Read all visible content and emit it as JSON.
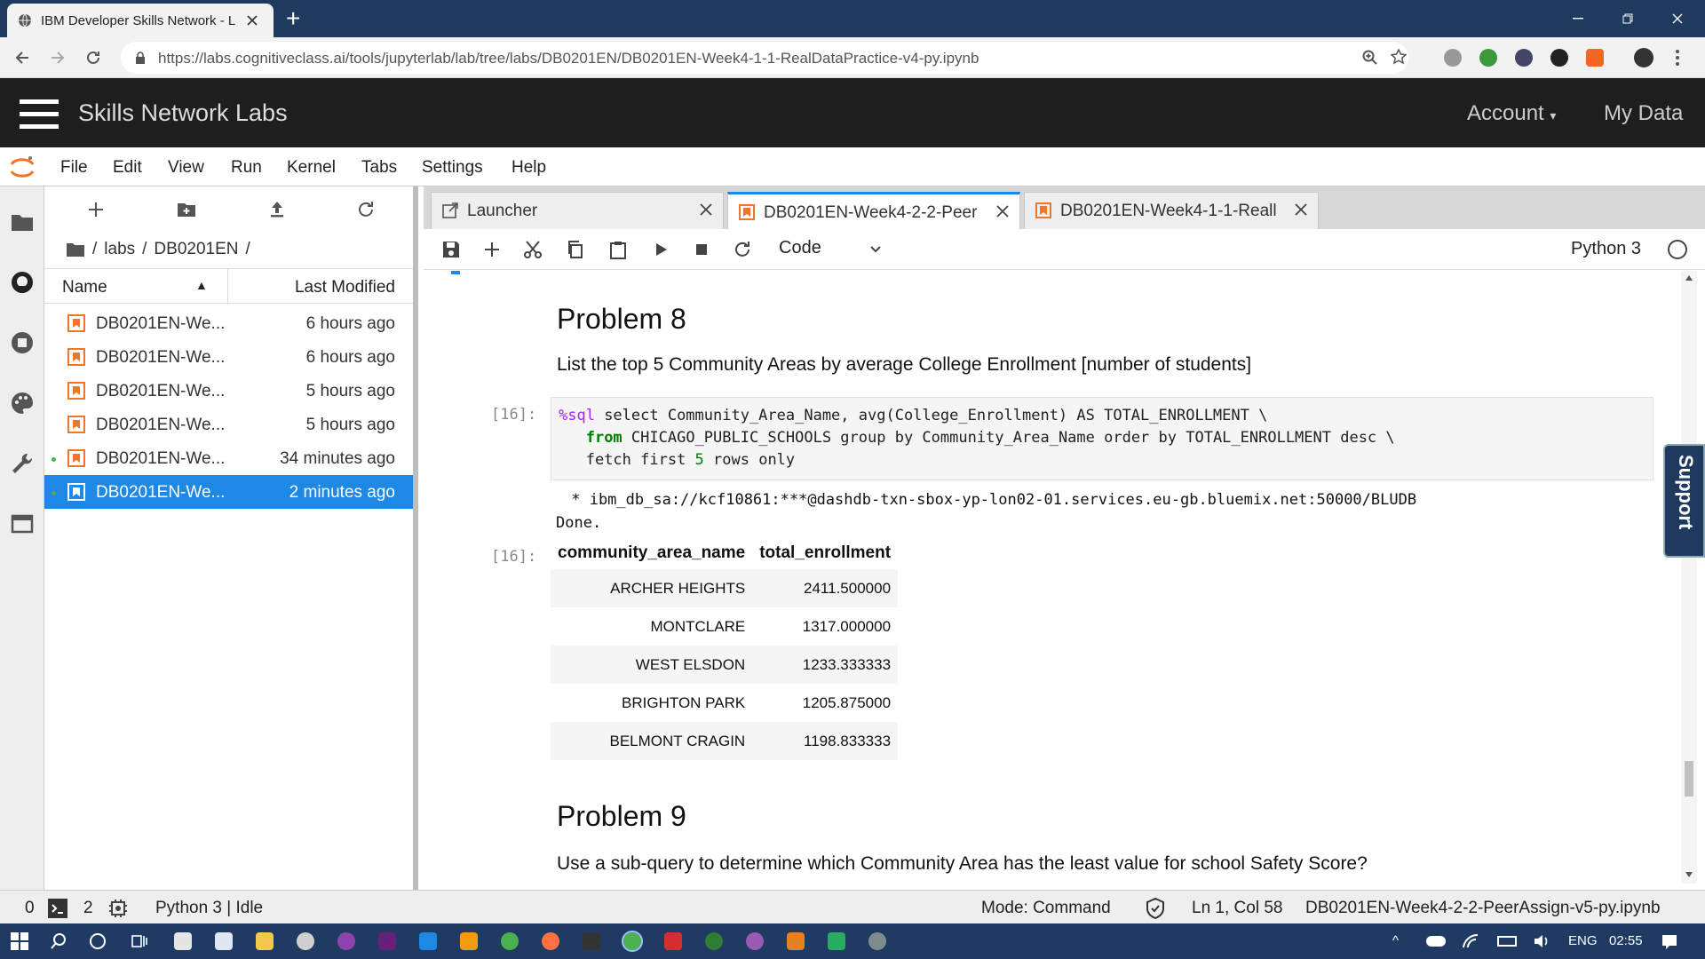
{
  "browser": {
    "tab_title": "IBM Developer Skills Network - L",
    "url": "https://labs.cognitiveclass.ai/tools/jupyterlab/lab/tree/labs/DB0201EN/DB0201EN-Week4-1-1-RealDataPractice-v4-py.ipynb"
  },
  "lab": {
    "brand": "Skills Network Labs",
    "account": "Account",
    "my_data": "My Data"
  },
  "menu": {
    "items": [
      "File",
      "Edit",
      "View",
      "Run",
      "Kernel",
      "Tabs",
      "Settings",
      "Help"
    ]
  },
  "filebrowser": {
    "breadcrumb": [
      "/",
      "labs",
      "/",
      "DB0201EN",
      "/"
    ],
    "col_name": "Name",
    "col_modified": "Last Modified",
    "files": [
      {
        "name": "DB0201EN-We...",
        "modified": "6 hours ago"
      },
      {
        "name": "DB0201EN-We...",
        "modified": "6 hours ago"
      },
      {
        "name": "DB0201EN-We...",
        "modified": "5 hours ago"
      },
      {
        "name": "DB0201EN-We...",
        "modified": "5 hours ago"
      },
      {
        "name": "DB0201EN-We...",
        "modified": "34 minutes ago"
      },
      {
        "name": "DB0201EN-We...",
        "modified": "2 minutes ago"
      }
    ]
  },
  "doc_tabs": [
    {
      "label": "Launcher"
    },
    {
      "label": "DB0201EN-Week4-2-2-Peer"
    },
    {
      "label": "DB0201EN-Week4-1-1-Reall"
    }
  ],
  "toolbar": {
    "cell_type": "Code",
    "kernel": "Python 3"
  },
  "notebook": {
    "problem8_title": "Problem 8",
    "problem8_text": "List the top 5 Community Areas by average College Enrollment [number of students]",
    "prompt_in": "[16]:",
    "prompt_out": "[16]:",
    "code": {
      "l1_magic": "%sql",
      "l1_rest": " select Community_Area_Name, avg(College_Enrollment) AS TOTAL_ENROLLMENT \\",
      "l2_kw": "from",
      "l2_rest": " CHICAGO_PUBLIC_SCHOOLS group by Community_Area_Name order by TOTAL_ENROLLMENT desc \\",
      "l3_a": "fetch first ",
      "l3_num": "5",
      "l3_b": " rows only"
    },
    "output_conn": " * ibm_db_sa://kcf10861:***@dashdb-txn-sbox-yp-lon02-01.services.eu-gb.bluemix.net:50000/BLUDB",
    "output_done": "Done.",
    "table": {
      "headers": [
        "community_area_name",
        "total_enrollment"
      ],
      "rows": [
        [
          "ARCHER HEIGHTS",
          "2411.500000"
        ],
        [
          "MONTCLARE",
          "1317.000000"
        ],
        [
          "WEST ELSDON",
          "1233.333333"
        ],
        [
          "BRIGHTON PARK",
          "1205.875000"
        ],
        [
          "BELMONT CRAGIN",
          "1198.833333"
        ]
      ]
    },
    "problem9_title": "Problem 9",
    "problem9_text": "Use a sub-query to determine which Community Area has the least value for school Safety Score?"
  },
  "support": "Support",
  "statusbar": {
    "terminals": "0",
    "kernels": "2",
    "kernel_status": "Python 3 | Idle",
    "mode": "Mode: Command",
    "position": "Ln 1, Col 58",
    "file": "DB0201EN-Week4-2-2-PeerAssign-v5-py.ipynb"
  },
  "taskbar": {
    "lang": "ENG",
    "time": "02:55"
  },
  "colors": {
    "accent": "#1e88e5",
    "notebook_icon": "#f37626",
    "topbar": "#1e1e1e",
    "taskbar": "#1f3a63"
  }
}
